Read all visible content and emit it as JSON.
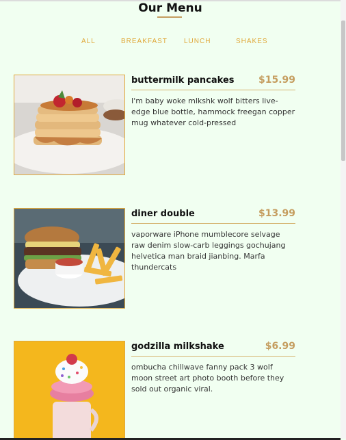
{
  "page": {
    "title": "Our Menu"
  },
  "tabs": [
    {
      "label": "ALL"
    },
    {
      "label": "BREAKFAST"
    },
    {
      "label": "LUNCH"
    },
    {
      "label": "SHAKES"
    }
  ],
  "menu": {
    "items": [
      {
        "name": "buttermilk pancakes",
        "price": "$15.99",
        "desc": "I'm baby woke mlkshk wolf bitters live-edge blue bottle, hammock freegan copper mug whatever cold-pressed"
      },
      {
        "name": "diner double",
        "price": "$13.99",
        "desc": "vaporware iPhone mumblecore selvage raw denim slow-carb leggings gochujang helvetica man braid jianbing. Marfa thundercats"
      },
      {
        "name": "godzilla milkshake",
        "price": "$6.99",
        "desc": "ombucha chillwave fanny pack 3 wolf moon street art photo booth before they sold out organic viral."
      }
    ]
  },
  "colors": {
    "accent": "#c59d5f",
    "tab_text": "#e0a83a",
    "background": "#f1fff1"
  }
}
